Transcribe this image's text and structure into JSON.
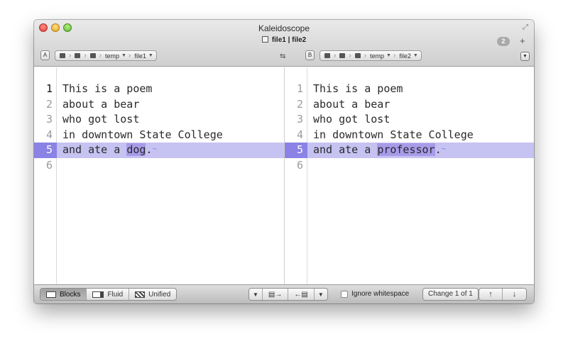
{
  "window": {
    "title": "Kaleidoscope",
    "tab_label": "file1 | file2",
    "tab_count": "2",
    "add_tab": "+"
  },
  "pathbar_a": {
    "badge": "A",
    "crumbs": [
      "temp",
      "file1"
    ]
  },
  "pathbar_b": {
    "badge": "B",
    "crumbs": [
      "temp",
      "file2"
    ]
  },
  "left_pane": {
    "lines": [
      {
        "num": "1",
        "text": "This is a poem"
      },
      {
        "num": "2",
        "text": "about a bear"
      },
      {
        "num": "3",
        "text": "who got lost"
      },
      {
        "num": "4",
        "text": "in downtown State College"
      },
      {
        "num": "5",
        "prefix": "and ate a ",
        "highlight": "dog",
        "suffix": ".",
        "marker": "¬"
      },
      {
        "num": "6",
        "text": ""
      }
    ]
  },
  "right_pane": {
    "lines": [
      {
        "num": "1",
        "text": "This is a poem"
      },
      {
        "num": "2",
        "text": "about a bear"
      },
      {
        "num": "3",
        "text": "who got lost"
      },
      {
        "num": "4",
        "text": "in downtown State College"
      },
      {
        "num": "5",
        "prefix": "and ate a ",
        "highlight": "professor",
        "suffix": ".",
        "marker": "¬"
      },
      {
        "num": "6",
        "text": ""
      }
    ]
  },
  "bottombar": {
    "modes": [
      "Blocks",
      "Fluid",
      "Unified"
    ],
    "active_mode": "Blocks",
    "ignore_whitespace": "Ignore whitespace",
    "change_status": "Change 1 of 1"
  },
  "colors": {
    "changed_line": "#c6c2f1",
    "changed_gutter": "#8a82e4",
    "changed_word": "#a79be9"
  }
}
